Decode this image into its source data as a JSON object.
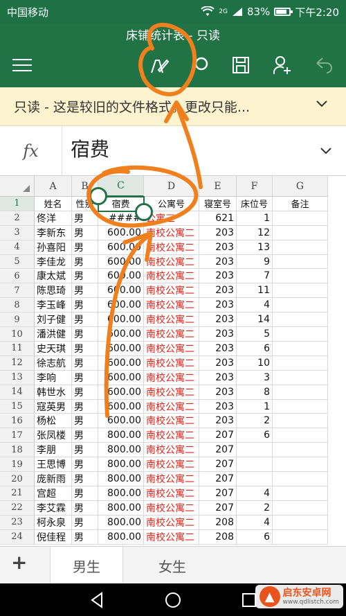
{
  "status": {
    "carrier": "中国移动",
    "signal_text": "2G",
    "battery": "83%",
    "time": "下午2:20"
  },
  "app": {
    "title": "床铺统计表 - 只读"
  },
  "toolbar": {
    "icons": [
      "menu-icon",
      "edit-pen-icon",
      "search-icon",
      "save-icon",
      "share-person-icon",
      "undo-icon"
    ]
  },
  "banner": {
    "text": "只读 - 这是较旧的文件格式。更改只能..."
  },
  "formula": {
    "fx_label": "fx",
    "value": "宿费"
  },
  "sheet": {
    "columns": [
      "A",
      "B",
      "C",
      "D",
      "E",
      "F",
      "G"
    ],
    "selected_column": "C",
    "selected_row": "1",
    "rows": [
      {
        "n": "1",
        "a": "姓名",
        "b": "性别",
        "c": "宿费",
        "d": "公寓号",
        "e": "寝室号",
        "f": "床位号",
        "g": "备注"
      },
      {
        "n": "2",
        "a": "佟洋",
        "b": "男",
        "c": "####",
        "d": "公寓三",
        "e": "621",
        "f": "1",
        "g": ""
      },
      {
        "n": "3",
        "a": "李新东",
        "b": "男",
        "c": "600.00",
        "d": "南校公寓二",
        "e": "203",
        "f": "12",
        "g": ""
      },
      {
        "n": "4",
        "a": "孙喜阳",
        "b": "男",
        "c": "600.00",
        "d": "南校公寓二",
        "e": "203",
        "f": "13",
        "g": ""
      },
      {
        "n": "5",
        "a": "李佳龙",
        "b": "男",
        "c": "600.00",
        "d": "南校公寓二",
        "e": "203",
        "f": "9",
        "g": ""
      },
      {
        "n": "6",
        "a": "康太斌",
        "b": "男",
        "c": "600.00",
        "d": "南校公寓二",
        "e": "203",
        "f": "7",
        "g": ""
      },
      {
        "n": "7",
        "a": "陈思琦",
        "b": "男",
        "c": "600.00",
        "d": "南校公寓二",
        "e": "203",
        "f": "11",
        "g": ""
      },
      {
        "n": "8",
        "a": "李玉峰",
        "b": "男",
        "c": "600.00",
        "d": "南校公寓二",
        "e": "203",
        "f": "4",
        "g": ""
      },
      {
        "n": "9",
        "a": "刘子健",
        "b": "男",
        "c": "600.00",
        "d": "南校公寓二",
        "e": "203",
        "f": "14",
        "g": ""
      },
      {
        "n": "10",
        "a": "潘洪健",
        "b": "男",
        "c": "600.00",
        "d": "南校公寓二",
        "e": "203",
        "f": "5",
        "g": ""
      },
      {
        "n": "11",
        "a": "史天琪",
        "b": "男",
        "c": "600.00",
        "d": "南校公寓二",
        "e": "203",
        "f": "6",
        "g": ""
      },
      {
        "n": "12",
        "a": "徐志航",
        "b": "男",
        "c": "600.00",
        "d": "南校公寓二",
        "e": "203",
        "f": "10",
        "g": ""
      },
      {
        "n": "13",
        "a": "李响",
        "b": "男",
        "c": "600.00",
        "d": "南校公寓二",
        "e": "203",
        "f": "3",
        "g": ""
      },
      {
        "n": "14",
        "a": "韩世水",
        "b": "男",
        "c": "600.00",
        "d": "南校公寓二",
        "e": "203",
        "f": "8",
        "g": ""
      },
      {
        "n": "15",
        "a": "寇英男",
        "b": "男",
        "c": "600.00",
        "d": "南校公寓二",
        "e": "203",
        "f": "1",
        "g": ""
      },
      {
        "n": "16",
        "a": "杨松",
        "b": "男",
        "c": "600.00",
        "d": "南校公寓二",
        "e": "203",
        "f": "2",
        "g": ""
      },
      {
        "n": "17",
        "a": "张凤楼",
        "b": "男",
        "c": "800.00",
        "d": "南校公寓二",
        "e": "207",
        "f": "6",
        "g": ""
      },
      {
        "n": "18",
        "a": "李朋",
        "b": "男",
        "c": "800.00",
        "d": "南校公寓二",
        "e": "207",
        "f": "",
        "g": ""
      },
      {
        "n": "19",
        "a": "王思博",
        "b": "男",
        "c": "800.00",
        "d": "南校公寓二",
        "e": "207",
        "f": "",
        "g": ""
      },
      {
        "n": "20",
        "a": "庞新雨",
        "b": "男",
        "c": "800.00",
        "d": "南校公寓二",
        "e": "207",
        "f": "",
        "g": ""
      },
      {
        "n": "21",
        "a": "宫超",
        "b": "男",
        "c": "800.00",
        "d": "南校公寓二",
        "e": "207",
        "f": "4",
        "g": ""
      },
      {
        "n": "22",
        "a": "李艾霖",
        "b": "男",
        "c": "800.00",
        "d": "南校公寓二",
        "e": "207",
        "f": "2",
        "g": ""
      },
      {
        "n": "23",
        "a": "柯永泉",
        "b": "男",
        "c": "800.00",
        "d": "南校公寓二",
        "e": "208",
        "f": "4",
        "g": ""
      },
      {
        "n": "24",
        "a": "倪佳程",
        "b": "男",
        "c": "800.00",
        "d": "南校公寓二",
        "e": "208",
        "f": "6",
        "g": ""
      }
    ]
  },
  "tabs": {
    "add_label": "+",
    "items": [
      "男生",
      "女生"
    ],
    "active": "男生"
  },
  "watermark": {
    "title": "启东安卓网",
    "url": "www.qdlistch.com"
  },
  "colors": {
    "brand": "#217346",
    "status": "#1e7145",
    "annotation": "#f07f1e",
    "red_text": "#e0261c",
    "banner": "#fdf3cf"
  }
}
